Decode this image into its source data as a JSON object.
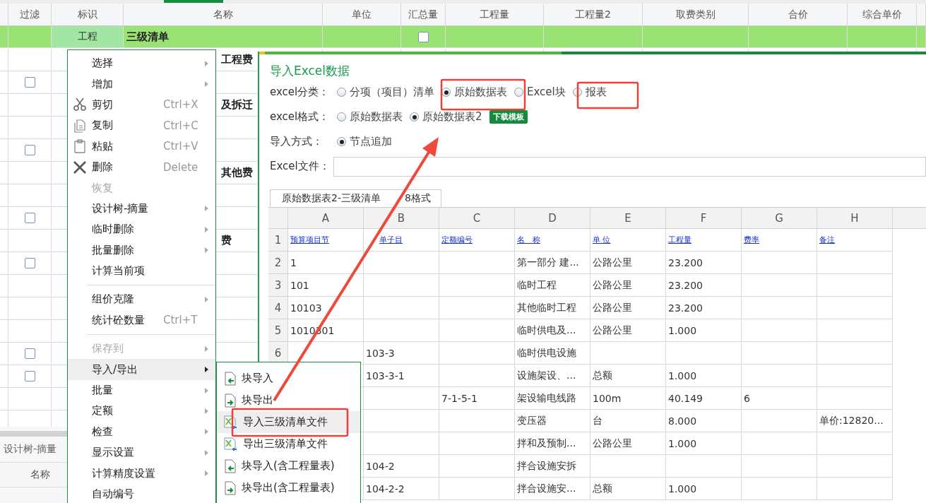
{
  "grid": {
    "columns": [
      "过滤",
      "标识",
      "名称",
      "单位",
      "汇总量",
      "工程量",
      "工程量2",
      "取费类别",
      "合价",
      "综合单价"
    ],
    "rows": [
      {
        "selected": true,
        "tag": "工程",
        "name": "三级清单",
        "total_checked": false
      },
      {
        "selected": false,
        "name": "工程费"
      },
      {
        "selected": false,
        "filter_checked": false
      },
      {
        "selected": false,
        "name": "及拆迁"
      },
      {
        "selected": false
      },
      {
        "selected": false,
        "filter_checked": false
      },
      {
        "selected": false,
        "name": "其他费"
      },
      {
        "selected": false
      },
      {
        "selected": false,
        "filter_checked": false
      },
      {
        "selected": false,
        "name": "费"
      },
      {
        "selected": false,
        "filter_checked": false
      },
      {
        "selected": false
      },
      {
        "selected": false
      },
      {
        "selected": false
      },
      {
        "selected": false,
        "filter_checked": false
      },
      {
        "selected": false,
        "filter_checked": false
      },
      {
        "selected": false
      },
      {
        "selected": false
      }
    ]
  },
  "bottom_panel": {
    "tab": "设计树-摘量",
    "column": "名称"
  },
  "context_menu": [
    {
      "kind": "plain",
      "label": "选择",
      "submenu": true,
      "disabled": false,
      "selected": false
    },
    {
      "kind": "plain",
      "label": "增加",
      "submenu": true,
      "disabled": false,
      "selected": false
    },
    {
      "kind": "cut",
      "label": "剪切",
      "shortcut": "Ctrl+X",
      "submenu": false,
      "disabled": false,
      "selected": false
    },
    {
      "kind": "copy",
      "label": "复制",
      "shortcut": "Ctrl+C",
      "submenu": false,
      "disabled": false,
      "selected": false
    },
    {
      "kind": "paste",
      "label": "粘贴",
      "shortcut": "Ctrl+V",
      "submenu": false,
      "disabled": false,
      "selected": false
    },
    {
      "kind": "delete",
      "label": "删除",
      "shortcut": "Delete",
      "submenu": false,
      "disabled": false,
      "selected": false
    },
    {
      "kind": "plain",
      "label": "恢复",
      "submenu": false,
      "disabled": true,
      "selected": false
    },
    {
      "kind": "plain",
      "label": "设计树-摘量",
      "submenu": true,
      "disabled": false,
      "selected": false
    },
    {
      "kind": "plain",
      "label": "临时删除",
      "submenu": true,
      "disabled": false,
      "selected": false
    },
    {
      "kind": "plain",
      "label": "批量删除",
      "submenu": true,
      "disabled": false,
      "selected": false
    },
    {
      "kind": "plain",
      "label": "计算当前项",
      "submenu": false,
      "disabled": false,
      "selected": false
    },
    {
      "kind": "separator"
    },
    {
      "kind": "plain",
      "label": "组价克隆",
      "submenu": true,
      "disabled": false,
      "selected": false
    },
    {
      "kind": "plain",
      "label": "统计砼数量",
      "shortcut": "Ctrl+T",
      "submenu": false,
      "disabled": false,
      "selected": false
    },
    {
      "kind": "separator"
    },
    {
      "kind": "plain",
      "label": "保存到",
      "submenu": true,
      "disabled": true,
      "selected": false
    },
    {
      "kind": "plain",
      "label": "导入/导出",
      "submenu": true,
      "disabled": false,
      "selected": true
    },
    {
      "kind": "plain",
      "label": "批量",
      "submenu": true,
      "disabled": false,
      "selected": false
    },
    {
      "kind": "plain",
      "label": "定额",
      "submenu": true,
      "disabled": false,
      "selected": false
    },
    {
      "kind": "plain",
      "label": "检查",
      "submenu": true,
      "disabled": false,
      "selected": false
    },
    {
      "kind": "plain",
      "label": "显示设置",
      "submenu": true,
      "disabled": false,
      "selected": false
    },
    {
      "kind": "plain",
      "label": "计算精度设置",
      "submenu": true,
      "disabled": false,
      "selected": false
    },
    {
      "kind": "plain",
      "label": "自动编号",
      "submenu": false,
      "disabled": false,
      "selected": false
    }
  ],
  "submenu": [
    {
      "kind": "import",
      "label": "块导入",
      "selected": false
    },
    {
      "kind": "export",
      "label": "块导出",
      "selected": false
    },
    {
      "kind": "excel-import",
      "label": "导入三级清单文件",
      "selected": true
    },
    {
      "kind": "excel-export",
      "label": "导出三级清单文件",
      "selected": false
    },
    {
      "kind": "import",
      "label": "块导入(含工程量表)",
      "selected": false
    },
    {
      "kind": "export",
      "label": "块导出(含工程量表)",
      "selected": false
    }
  ],
  "dialog": {
    "title": "导入Excel数据",
    "fields": [
      {
        "kind": "radio",
        "label": "excel分类：",
        "options": [
          {
            "label": "分项（项目）清单",
            "selected": false
          },
          {
            "label": "原始数据表",
            "selected": true
          },
          {
            "label": "Excel块",
            "selected": false
          },
          {
            "label": "报表",
            "selected": false
          }
        ]
      },
      {
        "kind": "radio",
        "label": "excel格式：",
        "options": [
          {
            "label": "原始数据表",
            "selected": false
          },
          {
            "label": "原始数据表2",
            "selected": true
          }
        ],
        "button": "下载模板"
      },
      {
        "kind": "radio",
        "label": "导入方式：",
        "options": [
          {
            "label": "节点追加",
            "selected": true
          }
        ]
      },
      {
        "kind": "file",
        "label": "Excel文件："
      }
    ],
    "sheet_tab": [
      "原始数据表2-三级清单",
      "8格式"
    ],
    "sheet": {
      "columns": [
        "A",
        "B",
        "C",
        "D",
        "E",
        "F",
        "G",
        "H"
      ],
      "rows": [
        {
          "kind": "header",
          "number": "1",
          "cells": {
            "A": "预算项目节",
            "B": "单子目",
            "C": "定额编号",
            "D": "名　称",
            "E": "单 位",
            "F": "工程量",
            "G": "费率",
            "H": "备注"
          }
        },
        {
          "kind": "data",
          "number": "2",
          "cells": {
            "A": "1",
            "D": "第一部分 建...",
            "E": "公路公里",
            "F": "23.200"
          }
        },
        {
          "kind": "data",
          "number": "3",
          "cells": {
            "A": "101",
            "D": "临时工程",
            "E": "公路公里",
            "F": "23.200"
          }
        },
        {
          "kind": "data",
          "number": "4",
          "cells": {
            "A": "10103",
            "D": "其他临时工程",
            "E": "公路公里",
            "F": "23.200"
          }
        },
        {
          "kind": "data",
          "number": "5",
          "cells": {
            "A": "1010301",
            "D": "临时供电及...",
            "E": "公路公里",
            "F": "1.000"
          }
        },
        {
          "kind": "data",
          "number": "6",
          "cells": {
            "B": "103-3",
            "D": "临时供电设施"
          }
        },
        {
          "kind": "data",
          "cells": {
            "B": "103-3-1",
            "D": "设施架设、...",
            "E": "总额",
            "F": "1.000"
          }
        },
        {
          "kind": "data",
          "cells": {
            "C": "7-1-5-1",
            "D": "架设输电线路",
            "E": "100m",
            "F": "40.149",
            "G": "6"
          }
        },
        {
          "kind": "data",
          "cells": {
            "D": "变压器",
            "E": "台",
            "F": "8.000",
            "H": "单价:12820..."
          }
        },
        {
          "kind": "data",
          "cells": {
            "D": "拌和及预制...",
            "E": "公路公里",
            "F": "1.000"
          }
        },
        {
          "kind": "data",
          "cells": {
            "B": "104-2",
            "D": "拌合设施安拆"
          }
        },
        {
          "kind": "data",
          "cells": {
            "B": "104-2-2",
            "D": "拌合设施安...",
            "E": "总额",
            "F": "1.000"
          }
        }
      ]
    }
  }
}
